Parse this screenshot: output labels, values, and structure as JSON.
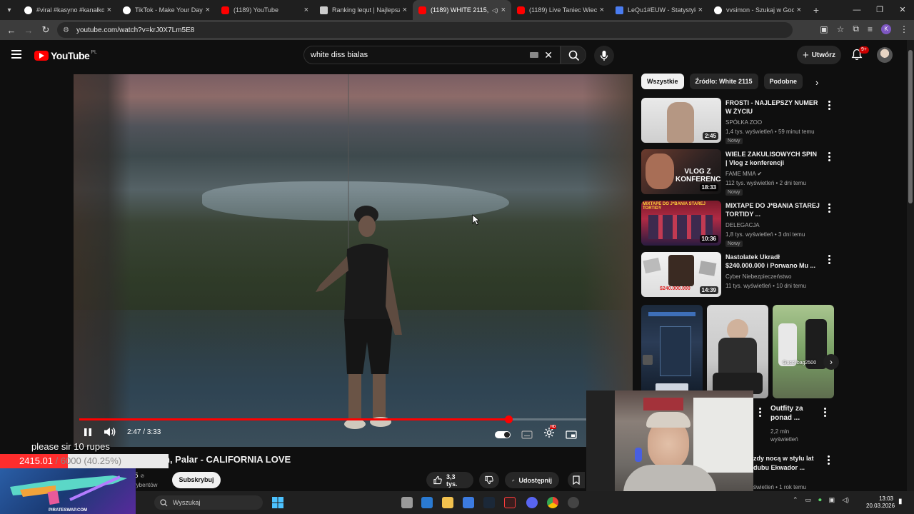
{
  "browser": {
    "tabs": [
      {
        "title": "#viral #kasyno #kanałkos",
        "favicon": "tiktok-icon",
        "color": "#ffffff",
        "active": false
      },
      {
        "title": "TikTok - Make Your Day",
        "favicon": "tiktok-icon",
        "color": "#ffffff",
        "active": false
      },
      {
        "title": "(1189) YouTube",
        "favicon": "youtube-icon",
        "color": "#ff0000",
        "active": false
      },
      {
        "title": "Ranking lequt | Najlepsze",
        "favicon": "diamond-icon",
        "color": "#cccccc",
        "active": false
      },
      {
        "title": "(1189) WHITE 2115, V",
        "favicon": "youtube-icon",
        "color": "#ff0000",
        "active": true
      },
      {
        "title": "(1189) Live Taniec Wieczn",
        "favicon": "youtube-icon",
        "color": "#ff0000",
        "active": false
      },
      {
        "title": "LeQu1#EUW - Statystyki",
        "favicon": "stats-icon",
        "color": "#4a7cf0",
        "active": false
      },
      {
        "title": "vvsimon - Szukaj w Goog",
        "favicon": "google-icon",
        "color": "#ffffff",
        "active": false
      }
    ],
    "url": "youtube.com/watch?v=krJ0X7Lm5E8"
  },
  "youtube": {
    "logo_text": "YouTube",
    "country_code": "PL",
    "search_value": "white diss bialas",
    "create_label": "Utwórz",
    "notifications_badge": "9+"
  },
  "player": {
    "time_current": "2:47",
    "time_total": "3:33",
    "time_label": "2:47 / 3:33",
    "progress_fraction": 0.784,
    "hd_badge": "HD"
  },
  "video": {
    "title_visible": "n, Palar - CALIFORNIA LOVE",
    "channel_tail": "5",
    "subs_tail": "rybentów",
    "subscribe_label": "Subskrybuj",
    "likes": "3,3 tys.",
    "share_label": "Udostępnij"
  },
  "sidebar": {
    "chips": [
      "Wszystkie",
      "Źródło: White 2115",
      "Podobne"
    ],
    "recommendations": [
      {
        "title": "FROSTI - NAJLEPSZY NUMER W ŻYCIU",
        "channel": "SPÓŁKA ZOO",
        "meta": "1,4 tys. wyświetleń • 59 minut temu",
        "badge": "Nowy",
        "duration": "2:45",
        "verified": false
      },
      {
        "title": "WIELE ZAKULISOWYCH SPIN | Vlog z konferencji",
        "channel": "FAME MMA",
        "meta": "112 tys. wyświetleń • 2 dni temu",
        "badge": "Nowy",
        "duration": "18:33",
        "verified": true
      },
      {
        "title": "MIXTAPE DO J*BANIA STAREJ TORTIDY ...",
        "channel": "DELEGACJA",
        "meta": "1,8 tys. wyświetleń • 3 dni temu",
        "badge": "Nowy",
        "duration": "10:36",
        "verified": false
      },
      {
        "title": "Nastolatek Ukradł $240.000.000 i Porwano Mu ...",
        "channel": "Cyber Niebezpieczeństwo",
        "meta": "11 tys. wyświetleń • 10 dni temu",
        "badge": "",
        "duration": "14:39",
        "verified": false
      }
    ],
    "shorts": [
      {
        "caption": "",
        "views": ""
      },
      {
        "caption": "",
        "views": ""
      },
      {
        "caption": "Outfity za ponad ...",
        "views": "2,2 mln wyświetleń"
      }
    ],
    "last_item": {
      "title": "zdy nocą w stylu lat dubu Ekwador ...",
      "meta": "świetleń • 1 rok temu"
    },
    "thumb_texts": {
      "vlog": "VLOG Z KONFERENCJI",
      "mixtape_overlay": "MIXTAPE DO J*BANIA STAREJ TORTIDY",
      "money": "$240.000.000",
      "short_overlay": "Gucci bag2500"
    }
  },
  "overlay": {
    "donation_message": "please sir 10 rupes",
    "goal_current": "2415.01",
    "goal_rest": " / 6000 (40.25%)",
    "goal_fraction": 0.4025,
    "promo_site": "PIRATESWAP.COM"
  },
  "taskbar": {
    "search_placeholder": "Wyszukaj",
    "time": "13:03",
    "date": "20.03.2026"
  },
  "colors": {
    "accent": "#ff0000",
    "background": "#0f0f0f",
    "chip_active": "#f1f1f1"
  }
}
